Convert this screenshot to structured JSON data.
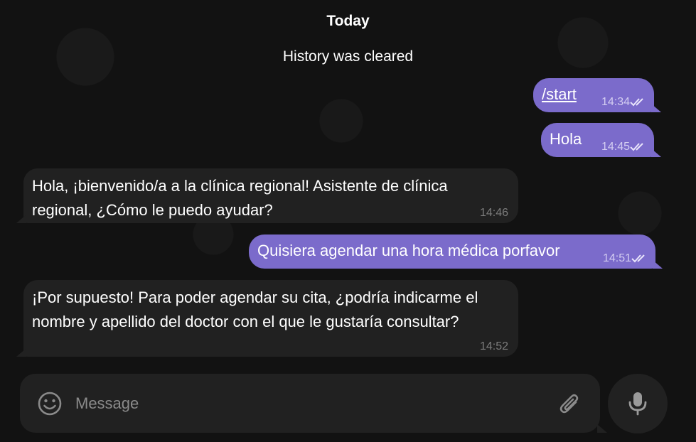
{
  "date_separator": "Today",
  "service_message": "History was cleared",
  "messages": [
    {
      "direction": "out",
      "text": "/start",
      "time": "14:34",
      "status": "read"
    },
    {
      "direction": "out",
      "text": "Hola",
      "time": "14:45",
      "status": "read"
    },
    {
      "direction": "in",
      "lines": [
        "Hola, ¡bienvenido/a a la clínica regional! Asistente de clínica",
        "regional, ¿Cómo le puedo ayudar?"
      ],
      "time": "14:46"
    },
    {
      "direction": "out",
      "text": "Quisiera agendar una hora médica porfavor",
      "time": "14:51",
      "status": "read"
    },
    {
      "direction": "in",
      "lines": [
        "¡Por supuesto! Para poder agendar su cita, ¿podría indicarme el",
        "nombre y apellido del doctor con el que le gustaría consultar?"
      ],
      "time": "14:52"
    }
  ],
  "composer": {
    "placeholder": "Message",
    "value": ""
  },
  "icons": {
    "emoji": "smiley-icon",
    "attach": "paperclip-icon",
    "mic": "microphone-icon",
    "read": "double-check-icon"
  },
  "colors": {
    "outgoing_bubble": "#7b6bcb",
    "incoming_bubble": "#212121",
    "background": "#121212"
  }
}
